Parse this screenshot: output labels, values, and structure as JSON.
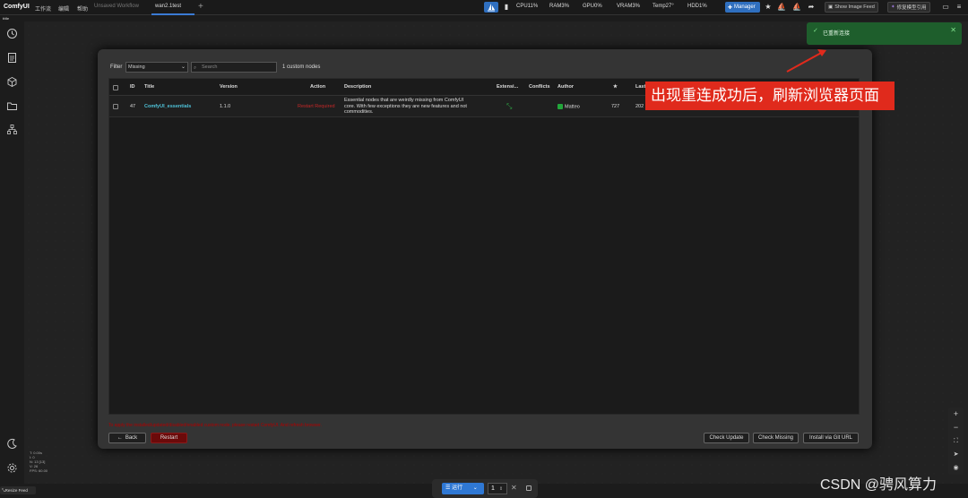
{
  "topbar": {
    "brand": "ComfyUI",
    "menus": [
      "工作流",
      "编辑",
      "帮助"
    ],
    "tabs": [
      {
        "label": "Unsaved Workflow",
        "active": false
      },
      {
        "label": "wan2.1test",
        "active": true
      }
    ],
    "stats": [
      "CPU11%",
      "RAM3%",
      "GPU0%",
      "VRAM3%",
      "Temp27°",
      "HDD1%"
    ],
    "manager_label": "Manager",
    "show_image_feed": "Show Image Feed",
    "repair_model_ref": "修复模型引用"
  },
  "sublabel": "title",
  "dialog": {
    "filter_label": "Filter",
    "filter_value": "Missing",
    "search_placeholder": "Search",
    "count_text": "1 custom nodes",
    "columns": [
      "ID",
      "Title",
      "Version",
      "Action",
      "Description",
      "Extensi...",
      "Conflicts",
      "Author",
      "★",
      "Last"
    ],
    "rows": [
      {
        "id": "47",
        "title": "ComfyUI_essentials",
        "version": "1.1.0",
        "action": "Restart Required",
        "description_lines": [
          "Essential nodes that are weirdly missing from ComfyUI",
          "core. With few exceptions they are new features and not",
          "commodities."
        ],
        "author": "Matteo",
        "stars": "727",
        "last": "202"
      }
    ],
    "warning": "To apply the installed/updated/disabled/enabled custom node, please restart ComfyUI. And refresh browser.",
    "back_label": "Back",
    "restart_label": "Restart",
    "check_update_label": "Check Update",
    "check_missing_label": "Check Missing",
    "install_git_label": "Install via Git URL"
  },
  "toast": {
    "message": "已重新连接"
  },
  "annotation": "出现重连成功后，刷新浏览器页面",
  "bottom_stats": [
    "T: 0.00s",
    "I: 0",
    "N: 13 [13]",
    "V: 26",
    "FPS: 60.00"
  ],
  "resize_feed": "Resize Feed",
  "runbar": {
    "run_label": "运行",
    "count": "1"
  },
  "watermark": "CSDN @骋风算力",
  "colors": {
    "accent": "#2f6fbf",
    "toast": "#1e5e2c",
    "annotation": "#e02a1c",
    "restart": "#6b0a0a"
  }
}
